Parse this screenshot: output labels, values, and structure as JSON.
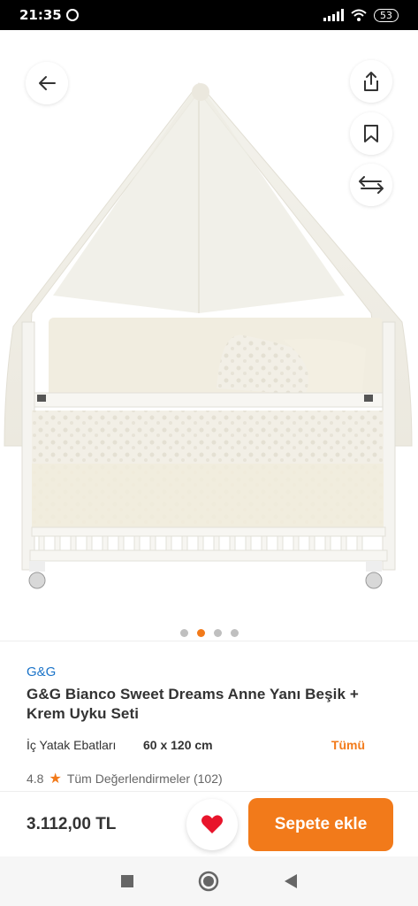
{
  "status_bar": {
    "time": "21:35",
    "battery": "53"
  },
  "hero": {
    "image_description": "product-photo-crib",
    "carousel": {
      "count": 4,
      "active_index": 1
    }
  },
  "product": {
    "brand": "G&G",
    "title": "G&G Bianco Sweet Dreams Anne Yanı Beşik + Krem Uyku Seti",
    "spec_label": "İç Yatak Ebatları",
    "spec_value": "60 x 120 cm",
    "spec_all": "Tümü",
    "rating": "4.8",
    "reviews_text": "Tüm Değerlendirmeler (102)"
  },
  "purchase": {
    "price": "3.112,00 TL",
    "add_to_cart": "Sepete ekle"
  },
  "colors": {
    "accent": "#f27a1a",
    "brand_link": "#1a73c8",
    "heart": "#e8142b"
  }
}
